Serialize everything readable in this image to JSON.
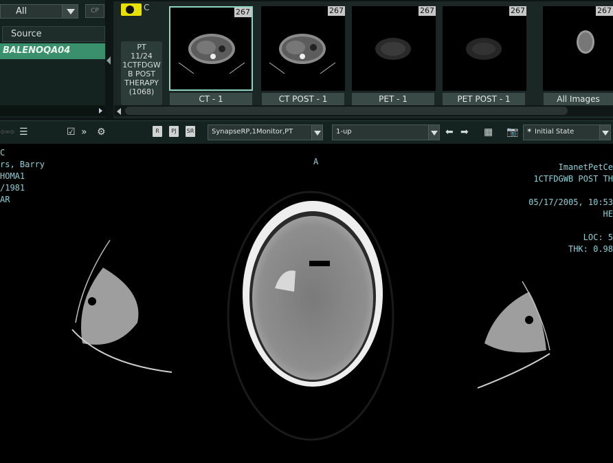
{
  "left_panel": {
    "filter_value": "All",
    "mini_button": "CP",
    "source_header": "Source",
    "source_rows": [
      "BALENOQA04"
    ]
  },
  "strip": {
    "letter": "C",
    "series_info": [
      "PT",
      "11/24",
      "1CTFDGW",
      "B POST",
      "THERAPY",
      "(1068)"
    ],
    "thumbnails": [
      {
        "label": "CT - 1",
        "count": "267"
      },
      {
        "label": "CT POST - 1",
        "count": "267"
      },
      {
        "label": "PET - 1",
        "count": "267"
      },
      {
        "label": "PET POST - 1",
        "count": "267"
      },
      {
        "label": "All Images",
        "count": "267"
      }
    ]
  },
  "toolbar": {
    "btn_r": "R",
    "btn_pj": "PJ",
    "btn_sr": "SR",
    "layout_select": "SynapseRP,1Monitor,PT",
    "view_select": "1-up",
    "state_select": "Initial State"
  },
  "viewer": {
    "top_left": [
      "C",
      "rs, Barry",
      "HOMA1",
      "/1981",
      "AR"
    ],
    "top_center": "A",
    "top_right": [
      "ImanetPetCe",
      "1CTFDGWB POST TH",
      "",
      "05/17/2005, 10:53",
      "HE",
      "",
      "LOC: 5",
      "THK: 0.98"
    ]
  }
}
